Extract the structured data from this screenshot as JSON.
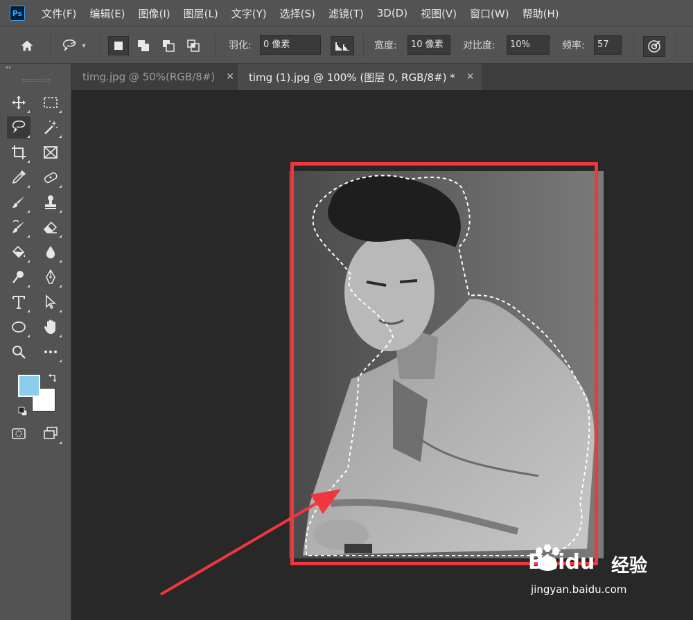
{
  "app": {
    "logo_text": "Ps"
  },
  "menu": [
    "文件(F)",
    "编辑(E)",
    "图像(I)",
    "图层(L)",
    "文字(Y)",
    "选择(S)",
    "滤镜(T)",
    "3D(D)",
    "视图(V)",
    "窗口(W)",
    "帮助(H)"
  ],
  "options": {
    "feather_label": "羽化:",
    "feather_value": "0 像素",
    "width_label": "宽度:",
    "width_value": "10 像素",
    "contrast_label": "对比度:",
    "contrast_value": "10%",
    "frequency_label": "频率:",
    "frequency_value": "57"
  },
  "tabs": [
    {
      "label": "timg.jpg @ 50%(RGB/8#)",
      "active": false
    },
    {
      "label": "timg (1).jpg @ 100% (图层 0, RGB/8#) *",
      "active": true
    }
  ],
  "colors": {
    "foreground": "#8ccdee",
    "background": "#ffffff",
    "highlight": "#f1373d",
    "panel": "#535353",
    "canvas": "#282828"
  },
  "watermark": {
    "brand": "Baidu",
    "brand_cn": "经验",
    "url": "jingyan.baidu.com"
  }
}
